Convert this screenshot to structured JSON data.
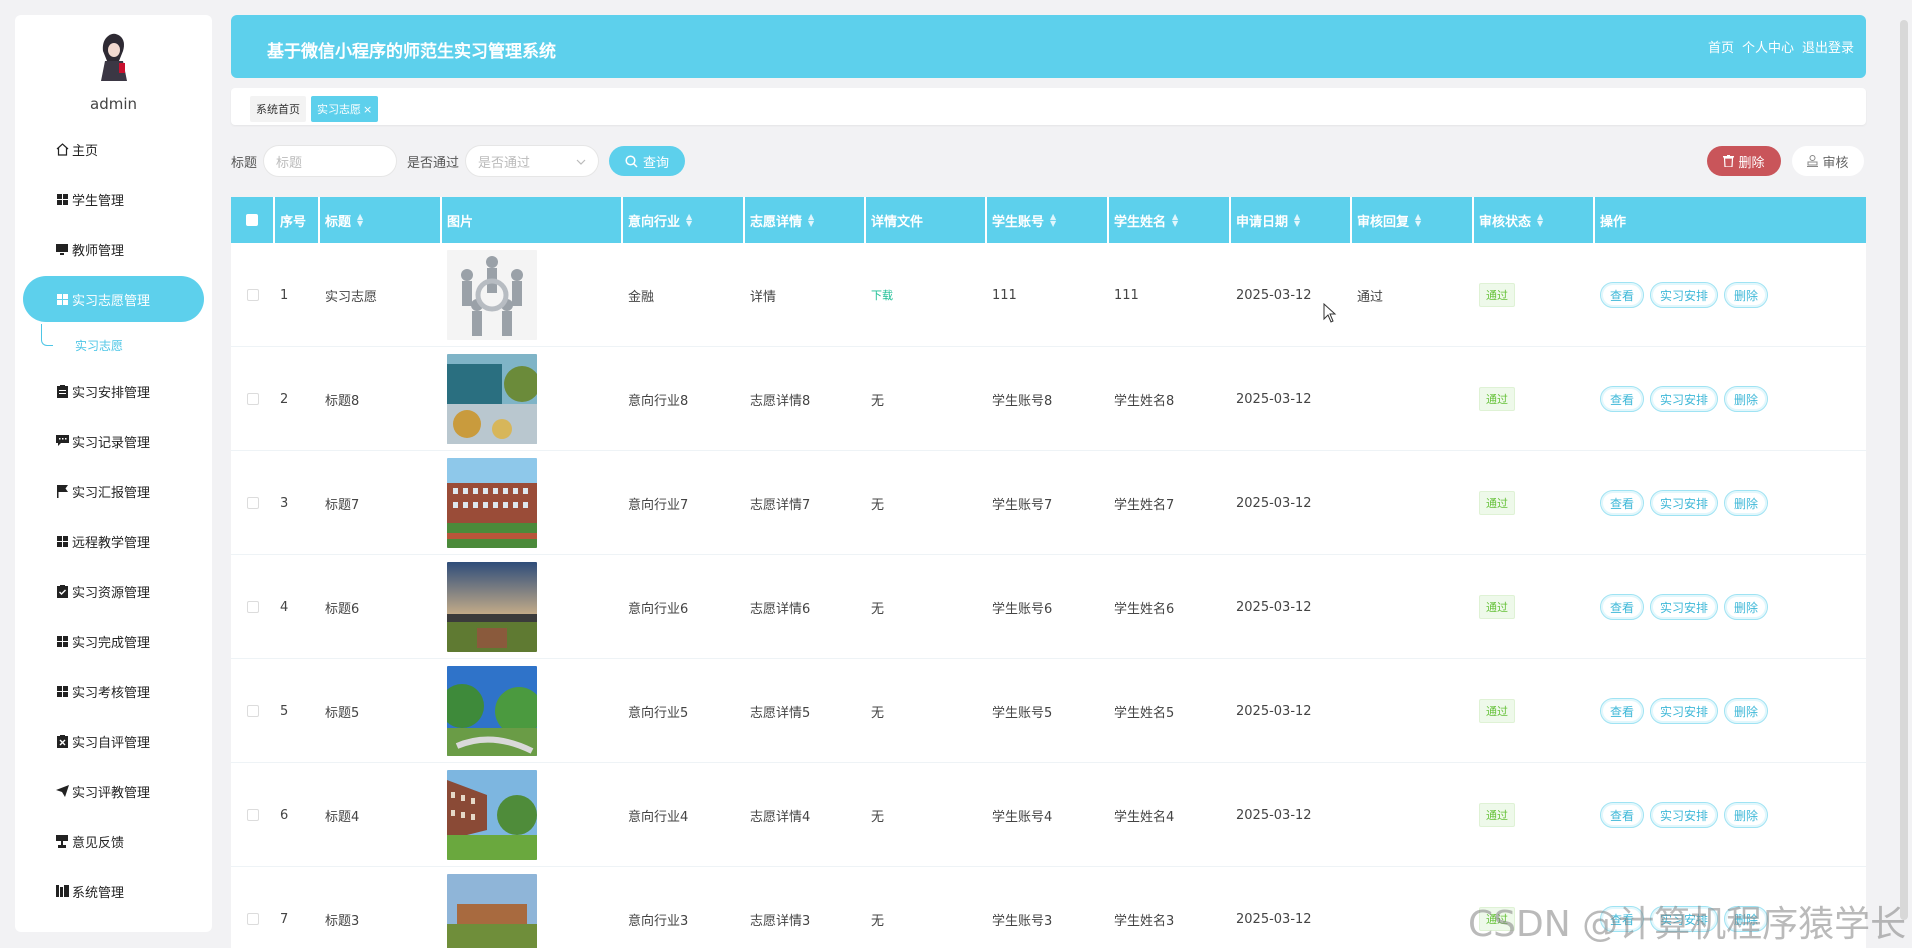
{
  "app": {
    "title": "基于微信小程序的师范生实习管理系统",
    "header_links": [
      "首页",
      "个人中心",
      "退出登录"
    ]
  },
  "user": {
    "name": "admin"
  },
  "sidebar": {
    "items": [
      {
        "label": "主页",
        "icon": "home-icon"
      },
      {
        "label": "学生管理",
        "icon": "grid-icon"
      },
      {
        "label": "教师管理",
        "icon": "monitor-icon"
      },
      {
        "label": "实习志愿管理",
        "icon": "grid-icon",
        "active": true
      },
      {
        "label": "实习安排管理",
        "icon": "clipboard-icon"
      },
      {
        "label": "实习记录管理",
        "icon": "chat-icon"
      },
      {
        "label": "实习汇报管理",
        "icon": "flag-icon"
      },
      {
        "label": "远程教学管理",
        "icon": "grid-icon"
      },
      {
        "label": "实习资源管理",
        "icon": "clipboard-check-icon"
      },
      {
        "label": "实习完成管理",
        "icon": "grid-icon"
      },
      {
        "label": "实习考核管理",
        "icon": "grid-icon"
      },
      {
        "label": "实习自评管理",
        "icon": "clipboard-x-icon"
      },
      {
        "label": "实习评教管理",
        "icon": "send-icon"
      },
      {
        "label": "意见反馈",
        "icon": "trophy-icon"
      },
      {
        "label": "系统管理",
        "icon": "books-icon"
      }
    ],
    "sub_item": "实习志愿"
  },
  "tabs": [
    "系统首页",
    "实习志愿"
  ],
  "filter": {
    "title_label": "标题",
    "title_placeholder": "标题",
    "pass_label": "是否通过",
    "pass_placeholder": "是否通过",
    "search_label": "查询",
    "delete_label": "删除",
    "audit_label": "审核"
  },
  "table": {
    "columns": [
      "序号",
      "标题",
      "图片",
      "意向行业",
      "志愿详情",
      "详情文件",
      "学生账号",
      "学生姓名",
      "申请日期",
      "审核回复",
      "审核状态",
      "操作"
    ],
    "rows": [
      {
        "no": "1",
        "title": "实习志愿",
        "industry": "金融",
        "detail": "详情",
        "file": "下载",
        "account": "111",
        "name": "111",
        "date": "2025-03-12",
        "reply": "通过",
        "status": "通过"
      },
      {
        "no": "2",
        "title": "标题8",
        "industry": "意向行业8",
        "detail": "志愿详情8",
        "file": "无",
        "account": "学生账号8",
        "name": "学生姓名8",
        "date": "2025-03-12",
        "reply": "",
        "status": "通过"
      },
      {
        "no": "3",
        "title": "标题7",
        "industry": "意向行业7",
        "detail": "志愿详情7",
        "file": "无",
        "account": "学生账号7",
        "name": "学生姓名7",
        "date": "2025-03-12",
        "reply": "",
        "status": "通过"
      },
      {
        "no": "4",
        "title": "标题6",
        "industry": "意向行业6",
        "detail": "志愿详情6",
        "file": "无",
        "account": "学生账号6",
        "name": "学生姓名6",
        "date": "2025-03-12",
        "reply": "",
        "status": "通过"
      },
      {
        "no": "5",
        "title": "标题5",
        "industry": "意向行业5",
        "detail": "志愿详情5",
        "file": "无",
        "account": "学生账号5",
        "name": "学生姓名5",
        "date": "2025-03-12",
        "reply": "",
        "status": "通过"
      },
      {
        "no": "6",
        "title": "标题4",
        "industry": "意向行业4",
        "detail": "志愿详情4",
        "file": "无",
        "account": "学生账号4",
        "name": "学生姓名4",
        "date": "2025-03-12",
        "reply": "",
        "status": "通过"
      },
      {
        "no": "7",
        "title": "标题3",
        "industry": "意向行业3",
        "detail": "志愿详情3",
        "file": "无",
        "account": "学生账号3",
        "name": "学生姓名3",
        "date": "2025-03-12",
        "reply": "",
        "status": "通过"
      }
    ],
    "actions": [
      "查看",
      "实习安排",
      "删除"
    ]
  },
  "watermark": "CSDN @计算机程序猿学长",
  "colors": {
    "accent": "#5dd0ec",
    "danger": "#c9555a",
    "success": "#67c23a"
  }
}
